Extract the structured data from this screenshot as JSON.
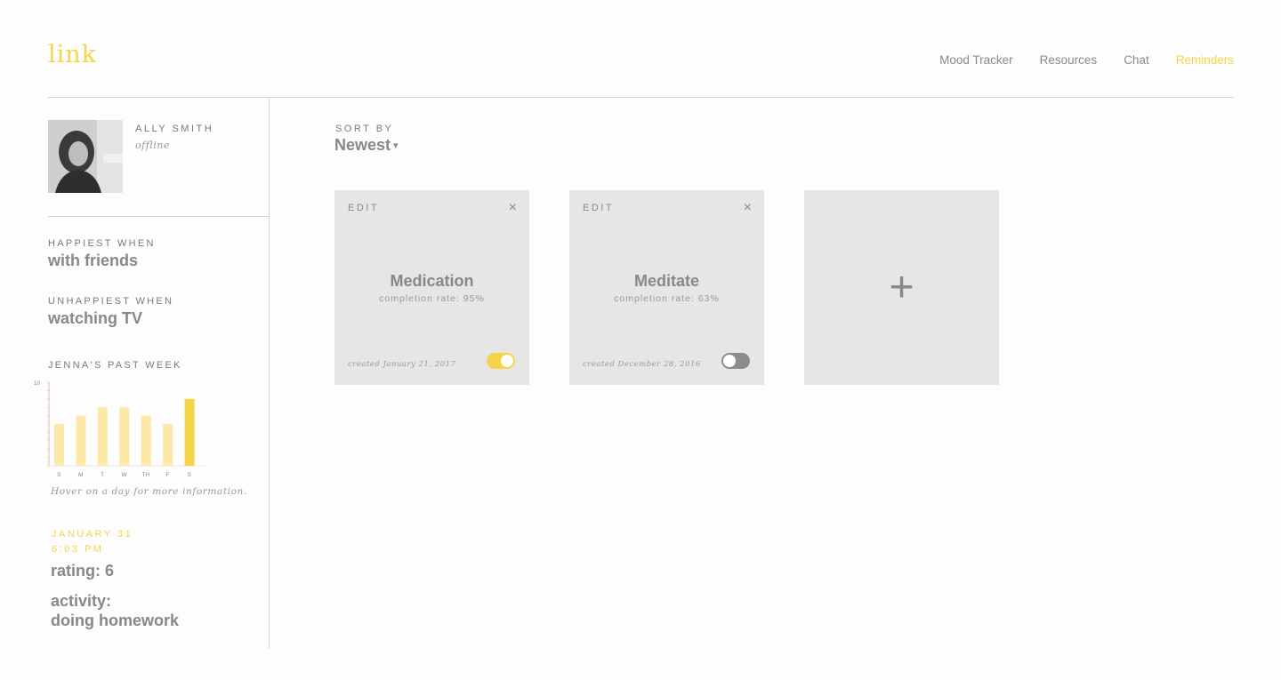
{
  "app": {
    "logo": "link"
  },
  "nav": {
    "items": [
      "Mood Tracker",
      "Resources",
      "Chat",
      "Reminders"
    ],
    "active_index": 3,
    "accent": "#f5d44a"
  },
  "profile": {
    "name": "ALLY SMITH",
    "status": "offline"
  },
  "mood": {
    "happiest_label": "HAPPIEST WHEN",
    "happiest_value": "with friends",
    "unhappiest_label": "UNHAPPIEST WHEN",
    "unhappiest_value": "watching TV"
  },
  "week": {
    "title": "JENNA'S PAST WEEK",
    "hint": "Hover on a day for more information."
  },
  "chart_data": {
    "type": "bar",
    "categories": [
      "S",
      "M",
      "T",
      "W",
      "TH",
      "F",
      "S"
    ],
    "values": [
      5,
      6,
      7,
      7,
      6,
      5,
      8
    ],
    "ylim": [
      0,
      10
    ],
    "yticks": [
      "10"
    ],
    "highlight_index": 6,
    "colors": {
      "bar": "#fde9a7",
      "highlight": "#f5d44a",
      "axis": "#e0b7b7"
    }
  },
  "detail": {
    "date": "JANUARY 31",
    "time": "6:03 PM",
    "rating": "rating: 6",
    "activity_label": "activity:",
    "activity_value": "doing homework"
  },
  "sort": {
    "label": "SORT BY",
    "value": "Newest",
    "caret": "▾"
  },
  "reminders": [
    {
      "edit": "EDIT",
      "close": "×",
      "title": "Medication",
      "rate": "completion rate: 95%",
      "created": "created January 21, 2017",
      "enabled": true
    },
    {
      "edit": "EDIT",
      "close": "×",
      "title": "Meditate",
      "rate": "completion rate: 63%",
      "created": "created December 28, 2016",
      "enabled": false
    }
  ],
  "add_card": {
    "symbol": "+"
  }
}
